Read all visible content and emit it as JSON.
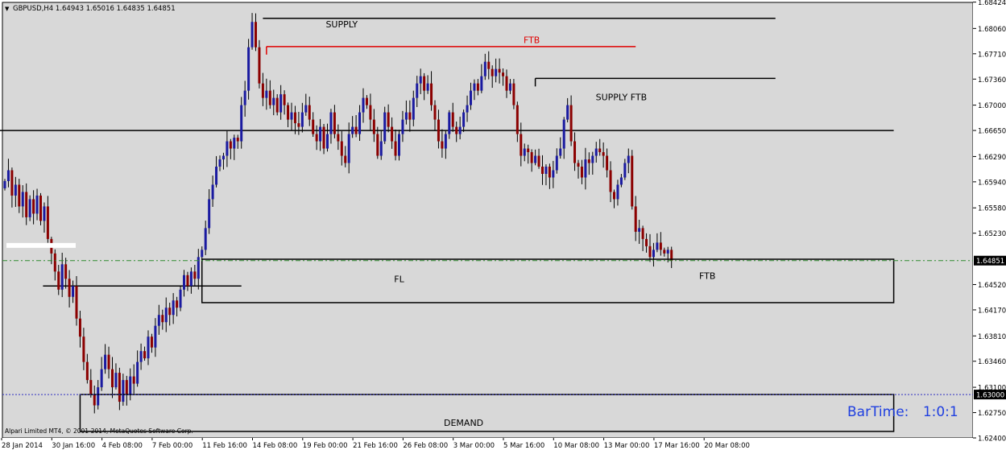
{
  "header": {
    "menu_arrow": "▼",
    "symbol_tf": "GBPUSD,H4",
    "ohlc": "1.64943 1.65016 1.64835 1.64851"
  },
  "footer": {
    "copyright": "Alpari Limited MT4, © 2001-2014, MetaQuotes Software Corp.",
    "bartime_label": "BarTime:",
    "bartime_value": "1:0:1"
  },
  "colors": {
    "background": "#d8d8d8",
    "bull": "#1a1aa0",
    "bear": "#8b0000",
    "wick": "#000000",
    "ftb_line": "#e00000",
    "bid_line": "#2e8b2e",
    "dotted_line": "#3030c0",
    "bartime_text": "#1f3fe0"
  },
  "chart_data": {
    "type": "candlestick",
    "symbol": "GBPUSD",
    "timeframe": "H4",
    "ylim": [
      1.624,
      1.6842
    ],
    "y_ticks": [
      "1.68424",
      "1.68060",
      "1.67710",
      "1.67360",
      "1.67000",
      "1.66650",
      "1.66290",
      "1.65940",
      "1.65580",
      "1.65230",
      "1.64520",
      "1.64170",
      "1.63810",
      "1.63460",
      "1.63100",
      "1.62750",
      "1.62400"
    ],
    "x_labels": [
      {
        "label": "28 Jan 2014",
        "idx": 0
      },
      {
        "label": "30 Jan 16:00",
        "idx": 14
      },
      {
        "label": "4 Feb 08:00",
        "idx": 28
      },
      {
        "label": "7 Feb 00:00",
        "idx": 42
      },
      {
        "label": "11 Feb 16:00",
        "idx": 56
      },
      {
        "label": "14 Feb 08:00",
        "idx": 70
      },
      {
        "label": "19 Feb 00:00",
        "idx": 84
      },
      {
        "label": "21 Feb 16:00",
        "idx": 98
      },
      {
        "label": "26 Feb 08:00",
        "idx": 112
      },
      {
        "label": "3 Mar 00:00",
        "idx": 126
      },
      {
        "label": "5 Mar 16:00",
        "idx": 140
      },
      {
        "label": "10 Mar 08:00",
        "idx": 154
      },
      {
        "label": "13 Mar 00:00",
        "idx": 168
      },
      {
        "label": "17 Mar 16:00",
        "idx": 182
      },
      {
        "label": "20 Mar 08:00",
        "idx": 196
      }
    ],
    "current_price": {
      "value": 1.64851,
      "label": "1.64851"
    },
    "dotted_level": {
      "value": 1.63,
      "label": "1.63000"
    },
    "closes": [
      1.6595,
      1.661,
      1.6575,
      1.659,
      1.656,
      1.658,
      1.6545,
      1.657,
      1.655,
      1.6575,
      1.654,
      1.656,
      1.6515,
      1.6495,
      1.647,
      1.6445,
      1.648,
      1.646,
      1.6435,
      1.645,
      1.6405,
      1.638,
      1.6345,
      1.632,
      1.63,
      1.6285,
      1.631,
      1.6335,
      1.6355,
      1.6335,
      1.631,
      1.633,
      1.629,
      1.632,
      1.63,
      1.6325,
      1.6315,
      1.6345,
      1.636,
      1.635,
      1.638,
      1.6365,
      1.6395,
      1.641,
      1.64,
      1.642,
      1.641,
      1.643,
      1.642,
      1.6445,
      1.6465,
      1.645,
      1.647,
      1.646,
      1.649,
      1.65,
      1.653,
      1.657,
      1.659,
      1.6615,
      1.6625,
      1.663,
      1.665,
      1.664,
      1.6655,
      1.665,
      1.67,
      1.672,
      1.678,
      1.6815,
      1.678,
      1.673,
      1.671,
      1.672,
      1.67,
      1.671,
      1.669,
      1.6715,
      1.67,
      1.668,
      1.669,
      1.6675,
      1.667,
      1.669,
      1.67,
      1.668,
      1.666,
      1.665,
      1.667,
      1.664,
      1.666,
      1.669,
      1.666,
      1.665,
      1.663,
      1.662,
      1.666,
      1.667,
      1.666,
      1.669,
      1.671,
      1.67,
      1.668,
      1.666,
      1.663,
      1.665,
      1.669,
      1.667,
      1.665,
      1.663,
      1.666,
      1.668,
      1.669,
      1.668,
      1.671,
      1.673,
      1.674,
      1.672,
      1.673,
      1.67,
      1.668,
      1.665,
      1.664,
      1.666,
      1.669,
      1.667,
      1.666,
      1.667,
      1.669,
      1.67,
      1.672,
      1.673,
      1.672,
      1.674,
      1.676,
      1.675,
      1.674,
      1.675,
      1.6745,
      1.674,
      1.672,
      1.673,
      1.67,
      1.666,
      1.663,
      1.664,
      1.6635,
      1.662,
      1.663,
      1.6615,
      1.6605,
      1.6615,
      1.66,
      1.661,
      1.663,
      1.664,
      1.668,
      1.67,
      1.665,
      1.662,
      1.6615,
      1.66,
      1.6625,
      1.662,
      1.663,
      1.664,
      1.6635,
      1.663,
      1.661,
      1.658,
      1.657,
      1.659,
      1.66,
      1.662,
      1.663,
      1.656,
      1.6525,
      1.653,
      1.6515,
      1.6505,
      1.649,
      1.65,
      1.651,
      1.65,
      1.6495,
      1.65,
      1.6485
    ],
    "zones": [
      {
        "label": "SUPPLY",
        "text_price": 1.6812,
        "text_idx": 94,
        "line_price": 1.682,
        "idx_start": 72,
        "idx_end": 215
      },
      {
        "label": "FTB",
        "text_price": 1.679,
        "text_idx": 147,
        "line_price": 1.6781,
        "idx_start": 73,
        "idx_end": 176,
        "color": "ftb"
      },
      {
        "label": "SUPPLY  FTB",
        "text_price": 1.6711,
        "text_idx": 172,
        "line_price": 1.6737,
        "idx_start": 148,
        "idx_end": 215
      },
      {
        "label": "FL",
        "text_price": 1.646,
        "text_idx": 110,
        "box_top": 1.6487,
        "box_bottom": 1.6427,
        "idx_start": 55,
        "idx_end": 248
      },
      {
        "label": "FTB",
        "text_price": 1.6464,
        "text_idx": 196
      },
      {
        "label": "DEMAND",
        "text_price": 1.6261,
        "text_idx": 128,
        "box_top": 1.63,
        "box_bottom": 1.6249,
        "idx_start": 21,
        "idx_end": 248
      }
    ],
    "levels": [
      {
        "price": 1.6665,
        "idx_start": 0,
        "idx_end": 248
      },
      {
        "price": 1.645,
        "idx_start": 12,
        "idx_end": 66
      }
    ]
  }
}
